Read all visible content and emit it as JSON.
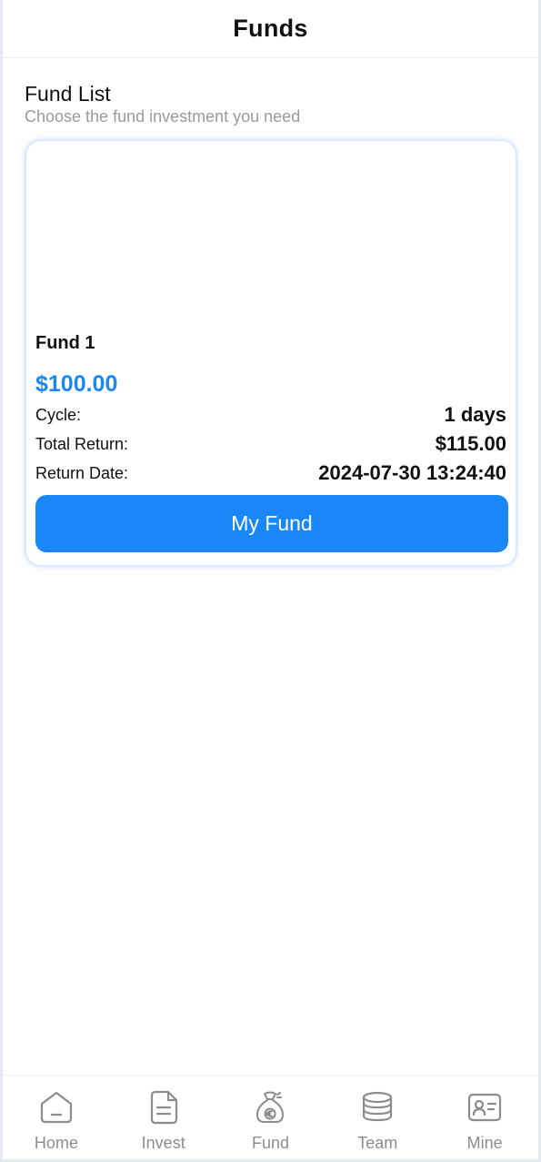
{
  "header": {
    "title": "Funds"
  },
  "fund_list": {
    "title": "Fund List",
    "subtitle": "Choose the fund investment you need"
  },
  "fund": {
    "name": "Fund 1",
    "price": "$100.00",
    "cycle_label": "Cycle:",
    "cycle_value": "1 days",
    "total_return_label": "Total Return:",
    "total_return_value": "$115.00",
    "return_date_label": "Return Date:",
    "return_date_value": "2024-07-30 13:24:40",
    "button_label": "My Fund"
  },
  "tabs": [
    {
      "label": "Home",
      "icon": "home-icon"
    },
    {
      "label": "Invest",
      "icon": "document-icon"
    },
    {
      "label": "Fund",
      "icon": "money-bag-icon"
    },
    {
      "label": "Team",
      "icon": "coin-stack-icon"
    },
    {
      "label": "Mine",
      "icon": "profile-card-icon"
    }
  ],
  "colors": {
    "accent": "#1a87f8",
    "price": "#1a87f5",
    "tab_inactive": "#8c8c8c"
  }
}
